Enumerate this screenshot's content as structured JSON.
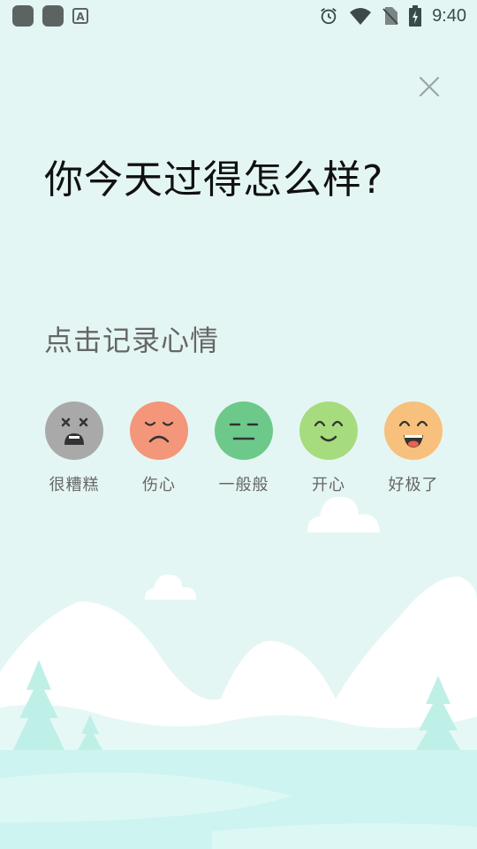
{
  "status_bar": {
    "time": "9:40",
    "left_icons": [
      "app-square-icon",
      "app-square-icon",
      "a-text-icon"
    ],
    "right_icons": [
      "alarm-clock-icon",
      "wifi-icon",
      "no-sim-icon",
      "battery-charging-icon"
    ]
  },
  "close_icon": "close-icon",
  "heading": "你今天过得怎么样?",
  "subheading": "点击记录心情",
  "moods": [
    {
      "label": "很糟糕",
      "color": "#a9a9a9",
      "icon": "dead-face-icon"
    },
    {
      "label": "伤心",
      "color": "#f4967a",
      "icon": "sad-face-icon"
    },
    {
      "label": "一般般",
      "color": "#6cc98a",
      "icon": "neutral-face-icon"
    },
    {
      "label": "开心",
      "color": "#a6dc7d",
      "icon": "smile-face-icon"
    },
    {
      "label": "好极了",
      "color": "#f7c07d",
      "icon": "laughing-face-icon"
    }
  ],
  "colors": {
    "background": "#e4f6f3",
    "mountain": "#ffffff",
    "tree": "#bff0e8",
    "water": "#cdf4f0"
  }
}
